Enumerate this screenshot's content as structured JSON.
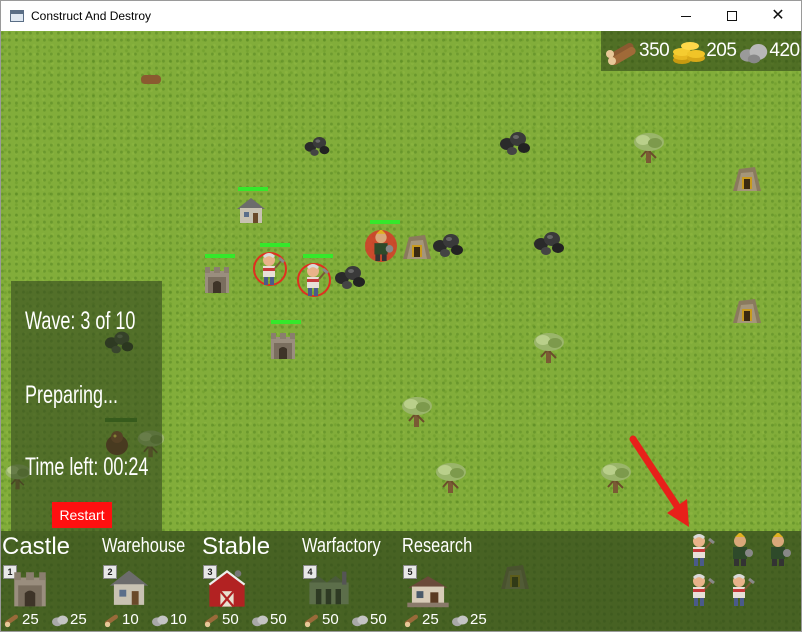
{
  "window": {
    "title": "Construct And Destroy",
    "minimize_label": "minimize",
    "maximize_label": "maximize",
    "close_label": "close"
  },
  "resources": {
    "wood": "350",
    "gold": "205",
    "stone": "420"
  },
  "wave": {
    "wave_text": "Wave: 3 of 10",
    "status_text": "Preparing...",
    "time_text": "Time left: 00:24",
    "restart_label": "Restart"
  },
  "buildings": [
    {
      "name": "Castle",
      "key": "1",
      "wood_cost": "25",
      "stone_cost": "25"
    },
    {
      "name": "Warehouse",
      "key": "2",
      "wood_cost": "10",
      "stone_cost": "10"
    },
    {
      "name": "Stable",
      "key": "3",
      "wood_cost": "50",
      "stone_cost": "50"
    },
    {
      "name": "Warfactory",
      "key": "4",
      "wood_cost": "50",
      "stone_cost": "50"
    },
    {
      "name": "Research",
      "key": "5",
      "wood_cost": "25",
      "stone_cost": "25"
    }
  ],
  "colors": {
    "grass": "#82ad3a",
    "health_bar": "#35e82b",
    "restart_button": "#ff1010"
  },
  "icons": {
    "wood": "wood-log-icon",
    "gold": "gold-coins-icon",
    "stone": "stone-icon"
  }
}
